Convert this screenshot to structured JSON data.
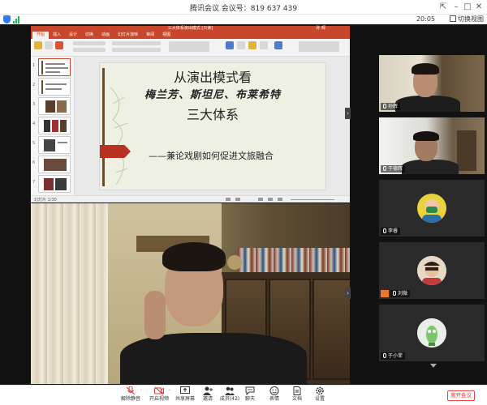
{
  "window": {
    "title": "腾讯会议 会议号：819 637 439",
    "clock": "20:05",
    "layout_button": "切换视图"
  },
  "powerpoint": {
    "file_title": "三大体系演出模式 [只读]",
    "tabs": [
      "开始",
      "插入",
      "设计",
      "切换",
      "动画",
      "幻灯片放映",
      "审阅",
      "视图"
    ],
    "active_tab": "开始",
    "user": "孙 辉",
    "thumbnail_numbers": [
      "1",
      "2",
      "3",
      "4",
      "5",
      "6",
      "7"
    ],
    "status_text": "幻灯片 1/30",
    "slide": {
      "line1": "从演出模式看",
      "line2": "梅兰芳、斯坦尼、布莱希特",
      "line3": "三大体系",
      "subtitle": "——兼论戏剧如何促进文旅融合"
    }
  },
  "participants": [
    {
      "name": "孙辉",
      "type": "video"
    },
    {
      "name": "于德辉",
      "type": "video"
    },
    {
      "name": "李睿",
      "type": "avatar",
      "avatar_color": "#e9d23a"
    },
    {
      "name": "刘微",
      "type": "avatar",
      "avatar_color": "#d9a37c",
      "host": true
    },
    {
      "name": "于小菲",
      "type": "avatar",
      "avatar_color": "#cfe2d2"
    }
  ],
  "toolbar": {
    "mute": "解除静音",
    "video": "开启视频",
    "share": "共享屏幕",
    "invite": "邀请",
    "members": "成员(42)",
    "chat": "聊天",
    "reactions": "表情",
    "docs": "文档",
    "settings": "设置",
    "leave": "离开会议"
  },
  "colors": {
    "accent": "#2f7bf5",
    "leave": "#e33333",
    "ppt": "#c8462b",
    "mute_red": "#e53935"
  }
}
